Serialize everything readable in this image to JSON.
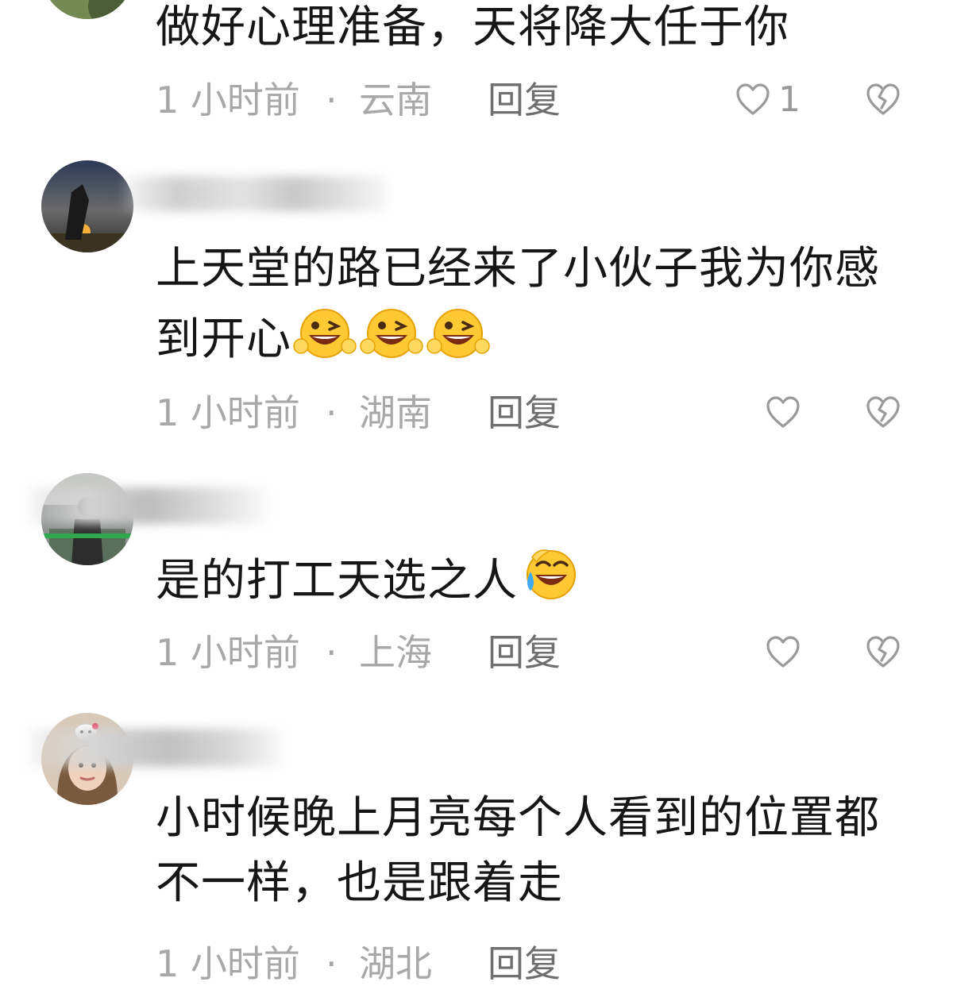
{
  "comments": [
    {
      "content": "做好心理准备，天将降大任于你",
      "time": "1 小时前",
      "separator": "·",
      "location": "云南",
      "reply_label": "回复",
      "like_count": "1"
    },
    {
      "content": "上天堂的路已经来了小伙子我为你感到开心",
      "emojis": [
        "grin-wink-emoji",
        "grin-wink-emoji",
        "grin-wink-emoji"
      ],
      "time": "1 小时前",
      "separator": "·",
      "location": "湖南",
      "reply_label": "回复",
      "like_count": ""
    },
    {
      "content": "是的打工天选之人",
      "emojis": [
        "laughing-tears-emoji"
      ],
      "time": "1 小时前",
      "separator": "·",
      "location": "上海",
      "reply_label": "回复",
      "like_count": ""
    },
    {
      "content": "小时候晚上月亮每个人看到的位置都不一样，也是跟着走",
      "time": "1 小时前",
      "separator": "·",
      "location": "湖北",
      "reply_label": "回复"
    }
  ],
  "colors": {
    "text_primary": "#161616",
    "text_meta": "#a8a8a8",
    "reply_text": "#6f6f6f",
    "icon_stroke": "#9a9a9a"
  },
  "icons": {
    "like": "heart-outline-icon",
    "dislike": "broken-heart-icon"
  }
}
